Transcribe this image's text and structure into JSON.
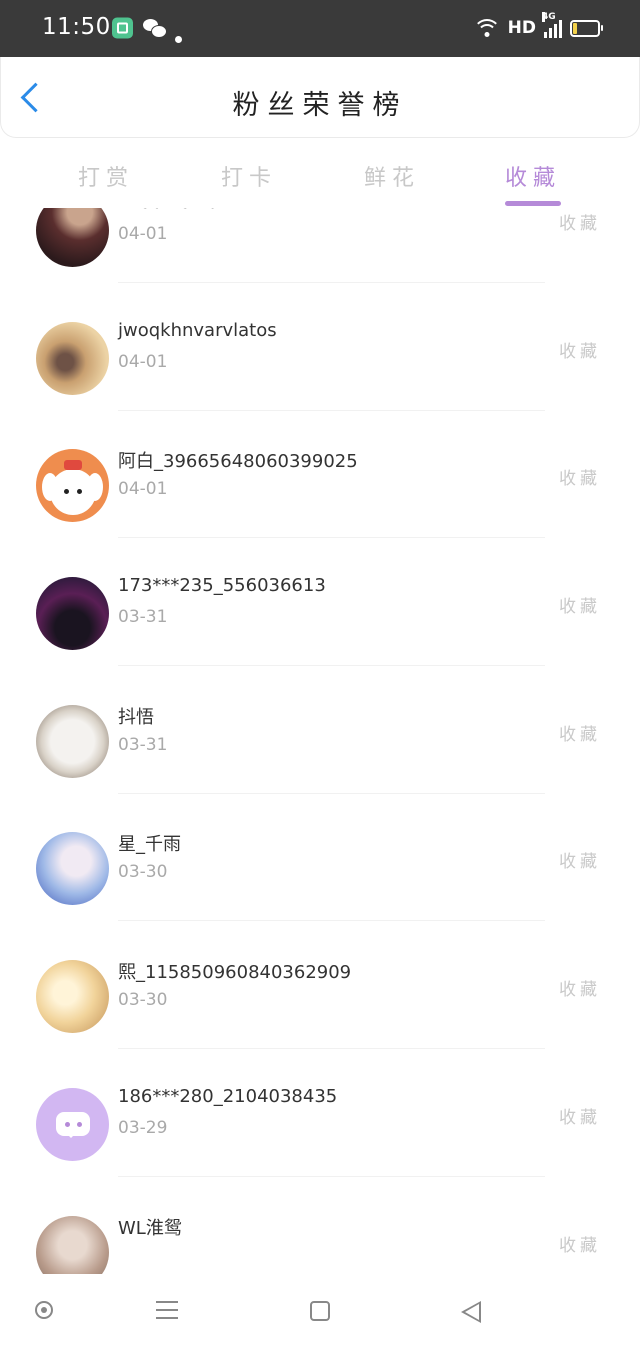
{
  "status_bar": {
    "time": "11:50",
    "network_label": "HD",
    "signal_label": "4G"
  },
  "header": {
    "title": "粉丝荣誉榜"
  },
  "tabs": [
    {
      "label": "打赏"
    },
    {
      "label": "打卡"
    },
    {
      "label": "鲜花"
    },
    {
      "label": "收藏"
    }
  ],
  "active_tab": "收藏",
  "fans": [
    {
      "name": "miaumaviu",
      "date": "04-01",
      "action": "收藏"
    },
    {
      "name": "jwoqkhnvarvlatos",
      "date": "04-01",
      "action": "收藏"
    },
    {
      "name": "阿白_39665648060399025",
      "date": "04-01",
      "action": "收藏"
    },
    {
      "name": "173***235_556036613",
      "date": "03-31",
      "action": "收藏"
    },
    {
      "name": "抖悟",
      "date": "03-31",
      "action": "收藏"
    },
    {
      "name": "星_千雨",
      "date": "03-30",
      "action": "收藏"
    },
    {
      "name": "熙_115850960840362909",
      "date": "03-30",
      "action": "收藏"
    },
    {
      "name": "186***280_2104038435",
      "date": "03-29",
      "action": "收藏"
    },
    {
      "name": "WL淮鸳",
      "date": "",
      "action": "收藏"
    }
  ],
  "colors": {
    "accent": "#b58ad8",
    "back_arrow": "#2b8be8"
  }
}
